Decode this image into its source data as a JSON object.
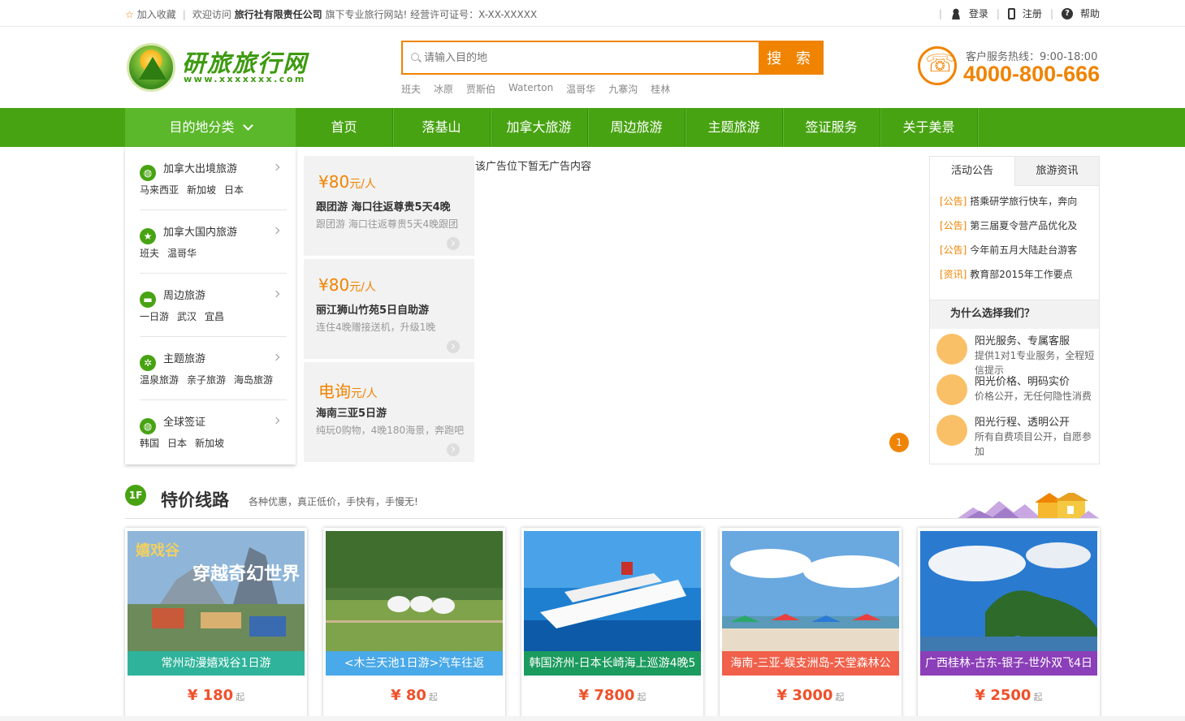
{
  "topbar": {
    "favorite": "加入收藏",
    "welcome_prefix": "欢迎访问",
    "company": "旅行社有限责任公司",
    "welcome_suffix": "旗下专业旅行网站! 经营许可证号：X-XX-XXXXX",
    "login": "登录",
    "register": "注册",
    "help": "帮助"
  },
  "header": {
    "logo_text": "研旅旅行网",
    "logo_url": "www.xxxxxxx.com",
    "search_placeholder": "请输入目的地",
    "search_button": "搜 索",
    "hot_words": [
      "班夫",
      "冰原",
      "贾斯伯",
      "Waterton",
      "温哥华",
      "九寨沟",
      "桂林"
    ],
    "hotline_label": "客户服务热线：9:00-18:00",
    "hotline_number": "4000-800-666"
  },
  "nav": {
    "category_label": "目的地分类",
    "items": [
      "首页",
      "落基山",
      "加拿大旅游",
      "周边旅游",
      "主题旅游",
      "签证服务",
      "关于美景"
    ]
  },
  "sidebar": [
    {
      "title": "加拿大出境旅游",
      "icon": "globe-icon",
      "subs": [
        "马来西亚",
        "新加坡",
        "日本"
      ]
    },
    {
      "title": "加拿大国内旅游",
      "icon": "star-globe-icon",
      "subs": [
        "班夫",
        "温哥华"
      ]
    },
    {
      "title": "周边旅游",
      "icon": "car-icon",
      "subs": [
        "一日游",
        "武汉",
        "宜昌"
      ]
    },
    {
      "title": "主题旅游",
      "icon": "palm-icon",
      "subs": [
        "温泉旅游",
        "亲子旅游",
        "海岛旅游"
      ]
    },
    {
      "title": "全球签证",
      "icon": "globe-icon",
      "subs": [
        "韩国",
        "日本",
        "新加坡"
      ]
    }
  ],
  "deals": [
    {
      "price": "¥80",
      "unit": "元/人",
      "title": "跟团游 海口往返尊贵5天4晚",
      "desc": "跟团游 海口往返尊贵5天4晚跟团"
    },
    {
      "price": "¥80",
      "unit": "元/人",
      "title": "丽江狮山竹苑5日自助游",
      "desc": "连住4晚赠接送机，升级1晚"
    },
    {
      "price": "电询",
      "unit": "元/人",
      "title": "海南三亚5日游",
      "desc": "纯玩0购物，4晚180海景，奔跑吧"
    }
  ],
  "ad": {
    "text": "该广告位下暂无广告内容",
    "page_bubble": "1"
  },
  "notice": {
    "tabs": [
      "活动公告",
      "旅游资讯"
    ],
    "items": [
      {
        "tag": "[公告]",
        "text": "搭乘研学旅行快车，奔向"
      },
      {
        "tag": "[公告]",
        "text": "第三届夏令营产品优化及"
      },
      {
        "tag": "[公告]",
        "text": "今年前五月大陆赴台游客"
      },
      {
        "tag": "[资讯]",
        "text": "教育部2015年工作要点"
      }
    ],
    "why_title": "为什么选择我们？",
    "why_items": [
      {
        "title": "阳光服务、专属客服",
        "desc": "提供1对1专业服务，全程短信提示"
      },
      {
        "title": "阳光价格、明码实价",
        "desc": "价格公开，无任何隐性消费"
      },
      {
        "title": "阳光行程、透明公开",
        "desc": "所有自费项目公开，自愿参加"
      }
    ]
  },
  "floor": {
    "badge": "1F",
    "title": "特价线路",
    "desc": "各种优惠，真正低价，手快有，手慢无!"
  },
  "cards": [
    {
      "caption": "常州动漫嬉戏谷1日游",
      "price": "¥ 180",
      "suffix": "起",
      "cap_color": "#2fb39a"
    },
    {
      "caption": "<木兰天池1日游>汽车往返",
      "price": "¥ 80",
      "suffix": "起",
      "cap_color": "#4aa9e8"
    },
    {
      "caption": "韩国济州-日本长崎海上巡游4晚5",
      "price": "¥ 7800",
      "suffix": "起",
      "cap_color": "#1c9b5e"
    },
    {
      "caption": "海南-三亚-蜈支洲岛-天堂森林公",
      "price": "¥ 3000",
      "suffix": "起",
      "cap_color": "#f0604a"
    },
    {
      "caption": "广西桂林-古东-银子-世外双飞4日",
      "price": "¥ 2500",
      "suffix": "起",
      "cap_color": "#8b3fb8"
    }
  ],
  "colors": {
    "brand_green": "#48a312",
    "accent_orange": "#f08300",
    "price_red": "#f0502a"
  }
}
